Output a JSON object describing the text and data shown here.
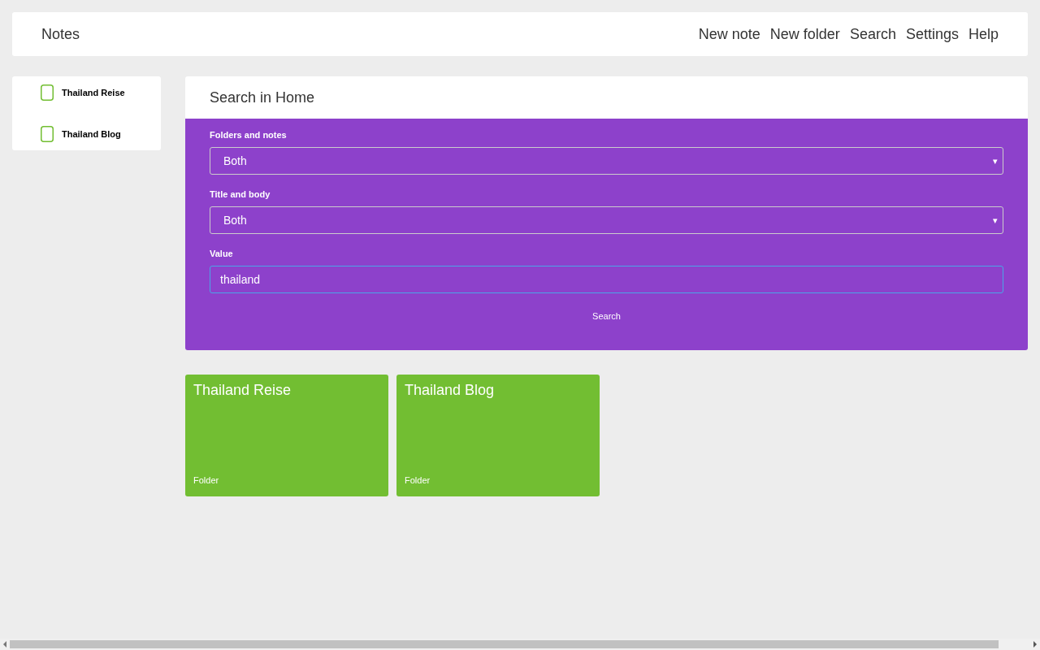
{
  "app_title": "Notes",
  "nav": [
    "New note",
    "New folder",
    "Search",
    "Settings",
    "Help"
  ],
  "sidebar": {
    "items": [
      {
        "label": "Thailand Reise"
      },
      {
        "label": "Thailand Blog"
      }
    ]
  },
  "search_panel": {
    "title": "Search in Home",
    "fields": [
      {
        "kind": "select",
        "label": "Folders and notes",
        "value": "Both",
        "caret": "▾"
      },
      {
        "kind": "select",
        "label": "Title and body",
        "value": "Both",
        "caret": "▾"
      },
      {
        "kind": "text",
        "label": "Value",
        "value": "thailand"
      }
    ],
    "button": "Search"
  },
  "results": [
    {
      "title": "Thailand Reise",
      "type": "Folder"
    },
    {
      "title": "Thailand Blog",
      "type": "Folder"
    }
  ]
}
